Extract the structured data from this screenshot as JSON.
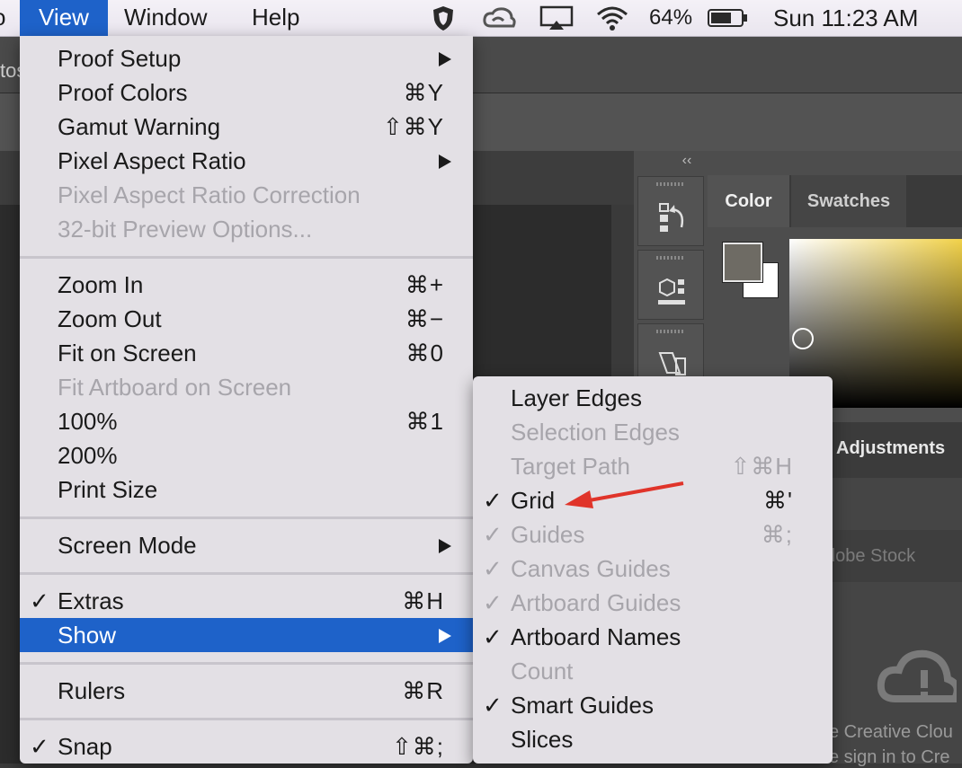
{
  "menubar": {
    "cut_item": "o",
    "view": "View",
    "window": "Window",
    "help": "Help",
    "battery_percent": "64%",
    "clock": "Sun 11:23 AM",
    "status_icons": [
      "shield-icon",
      "creative-cloud-icon",
      "airplay-icon",
      "wifi-icon",
      "battery-icon"
    ]
  },
  "photoshop": {
    "app_fragment": "tos",
    "collapse": "‹‹",
    "color_tab": "Color",
    "swatches_tab": "Swatches",
    "adjustments_tab": "Adjustments",
    "stock_fragment": "dobe Stock",
    "cc_line1": "e Creative Clou",
    "cc_line2": "e sign in to Cre",
    "foreground_color": "#6e6b64",
    "background_color": "#ffffff"
  },
  "view_menu": {
    "items": [
      {
        "label": "Proof Setup",
        "shortcut": "",
        "submenu": true,
        "disabled": false,
        "checked": false
      },
      {
        "label": "Proof Colors",
        "shortcut": "⌘Y",
        "submenu": false,
        "disabled": false,
        "checked": false
      },
      {
        "label": "Gamut Warning",
        "shortcut": "⇧⌘Y",
        "submenu": false,
        "disabled": false,
        "checked": false
      },
      {
        "label": "Pixel Aspect Ratio",
        "shortcut": "",
        "submenu": true,
        "disabled": false,
        "checked": false
      },
      {
        "label": "Pixel Aspect Ratio Correction",
        "shortcut": "",
        "submenu": false,
        "disabled": true,
        "checked": false
      },
      {
        "label": "32-bit Preview Options...",
        "shortcut": "",
        "submenu": false,
        "disabled": true,
        "checked": false
      },
      {
        "label": "Zoom In",
        "shortcut": "⌘+",
        "submenu": false,
        "disabled": false,
        "checked": false
      },
      {
        "label": "Zoom Out",
        "shortcut": "⌘−",
        "submenu": false,
        "disabled": false,
        "checked": false
      },
      {
        "label": "Fit on Screen",
        "shortcut": "⌘0",
        "submenu": false,
        "disabled": false,
        "checked": false
      },
      {
        "label": "Fit Artboard on Screen",
        "shortcut": "",
        "submenu": false,
        "disabled": true,
        "checked": false
      },
      {
        "label": "100%",
        "shortcut": "⌘1",
        "submenu": false,
        "disabled": false,
        "checked": false
      },
      {
        "label": "200%",
        "shortcut": "",
        "submenu": false,
        "disabled": false,
        "checked": false
      },
      {
        "label": "Print Size",
        "shortcut": "",
        "submenu": false,
        "disabled": false,
        "checked": false
      },
      {
        "label": "Screen Mode",
        "shortcut": "",
        "submenu": true,
        "disabled": false,
        "checked": false
      },
      {
        "label": "Extras",
        "shortcut": "⌘H",
        "submenu": false,
        "disabled": false,
        "checked": true
      },
      {
        "label": "Show",
        "shortcut": "",
        "submenu": true,
        "disabled": false,
        "checked": false,
        "highlighted": true
      },
      {
        "label": "Rulers",
        "shortcut": "⌘R",
        "submenu": false,
        "disabled": false,
        "checked": false
      },
      {
        "label": "Snap",
        "shortcut": "⇧⌘;",
        "submenu": false,
        "disabled": false,
        "checked": true
      }
    ]
  },
  "show_menu": {
    "items": [
      {
        "label": "Layer Edges",
        "shortcut": "",
        "disabled": false,
        "checked": false
      },
      {
        "label": "Selection Edges",
        "shortcut": "",
        "disabled": true,
        "checked": false
      },
      {
        "label": "Target Path",
        "shortcut": "⇧⌘H",
        "disabled": true,
        "checked": false
      },
      {
        "label": "Grid",
        "shortcut": "⌘'",
        "disabled": false,
        "checked": true
      },
      {
        "label": "Guides",
        "shortcut": "⌘;",
        "disabled": true,
        "checked": true
      },
      {
        "label": "Canvas Guides",
        "shortcut": "",
        "disabled": true,
        "checked": true
      },
      {
        "label": "Artboard Guides",
        "shortcut": "",
        "disabled": true,
        "checked": true
      },
      {
        "label": "Artboard Names",
        "shortcut": "",
        "disabled": false,
        "checked": true
      },
      {
        "label": "Count",
        "shortcut": "",
        "disabled": true,
        "checked": false
      },
      {
        "label": "Smart Guides",
        "shortcut": "",
        "disabled": false,
        "checked": true
      },
      {
        "label": "Slices",
        "shortcut": "",
        "disabled": false,
        "checked": false
      }
    ]
  },
  "annotation": {
    "arrow_color": "#e0342a"
  }
}
